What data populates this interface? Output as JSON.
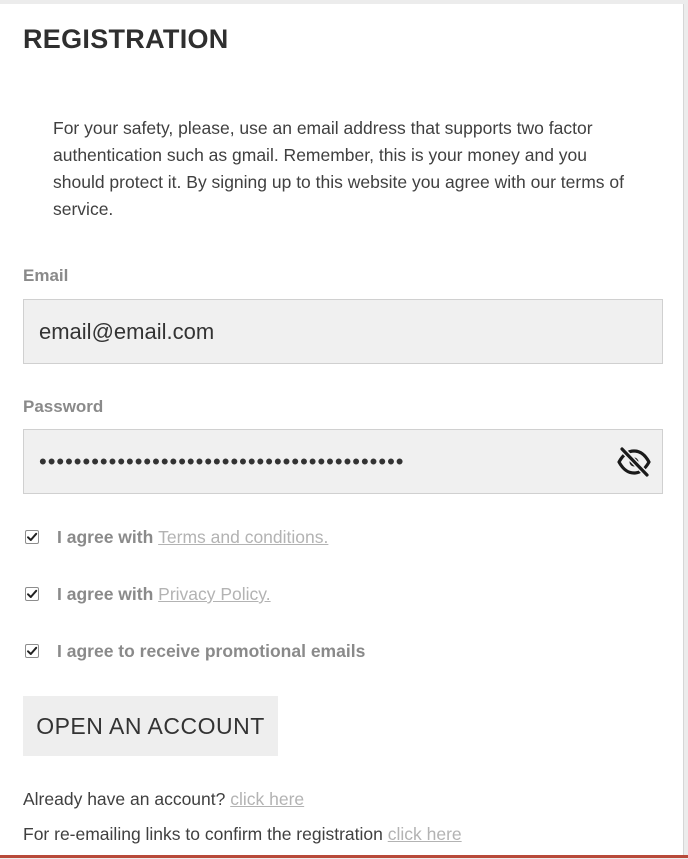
{
  "form": {
    "title": "REGISTRATION",
    "notice": "For your safety, please, use an email address that supports two factor authentication such as gmail. Remember, this is your money and you should protect it. By signing up to this website you agree with our terms of service."
  },
  "email": {
    "label": "Email",
    "value": "email@email.com"
  },
  "password": {
    "label": "Password",
    "value": "••••••••••••••••••••••••••••••••••••••••••",
    "toggle_icon": "eye-off-icon"
  },
  "agreements": [
    {
      "text": "I agree with ",
      "link": "Terms and conditions.",
      "checked": true
    },
    {
      "text": "I agree with ",
      "link": "Privacy Policy.",
      "checked": true
    },
    {
      "text": "I agree to receive promotional emails",
      "link": "",
      "checked": true
    }
  ],
  "submit_label": "OPEN AN ACCOUNT",
  "footer": {
    "login_text": "Already have an account? ",
    "login_link": "click here",
    "reconfirm_text": "For re-emailing links to confirm the registration ",
    "reconfirm_link": "click here"
  },
  "colors": {
    "input_background": "#f0f0f0",
    "link": "#b3b3b3",
    "label": "#8a8a8a",
    "text": "#404040",
    "bottom_accent": "#b84a3a"
  }
}
